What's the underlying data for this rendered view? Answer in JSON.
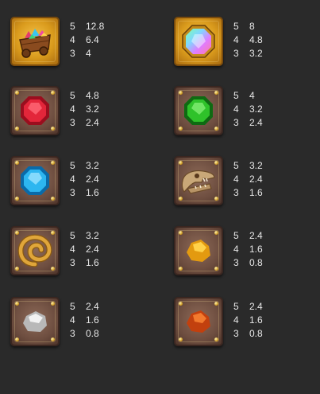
{
  "colors": {
    "background": "#2a2a2a",
    "text": "#e8e8e8"
  },
  "paytable": [
    {
      "symbol": "gem-cart-icon",
      "frame": "gold",
      "payouts": [
        {
          "count": "5",
          "value": "12.8"
        },
        {
          "count": "4",
          "value": "6.4"
        },
        {
          "count": "3",
          "value": "4"
        }
      ]
    },
    {
      "symbol": "rainbow-diamond-icon",
      "frame": "gold",
      "payouts": [
        {
          "count": "5",
          "value": "8"
        },
        {
          "count": "4",
          "value": "4.8"
        },
        {
          "count": "3",
          "value": "3.2"
        }
      ]
    },
    {
      "symbol": "red-gem-icon",
      "frame": "stone",
      "payouts": [
        {
          "count": "5",
          "value": "4.8"
        },
        {
          "count": "4",
          "value": "3.2"
        },
        {
          "count": "3",
          "value": "2.4"
        }
      ]
    },
    {
      "symbol": "green-gem-icon",
      "frame": "stone",
      "payouts": [
        {
          "count": "5",
          "value": "4"
        },
        {
          "count": "4",
          "value": "3.2"
        },
        {
          "count": "3",
          "value": "2.4"
        }
      ]
    },
    {
      "symbol": "blue-gem-icon",
      "frame": "stone",
      "payouts": [
        {
          "count": "5",
          "value": "3.2"
        },
        {
          "count": "4",
          "value": "2.4"
        },
        {
          "count": "3",
          "value": "1.6"
        }
      ]
    },
    {
      "symbol": "dinosaur-skull-icon",
      "frame": "stone",
      "payouts": [
        {
          "count": "5",
          "value": "3.2"
        },
        {
          "count": "4",
          "value": "2.4"
        },
        {
          "count": "3",
          "value": "1.6"
        }
      ]
    },
    {
      "symbol": "ammonite-fossil-icon",
      "frame": "stone",
      "payouts": [
        {
          "count": "5",
          "value": "3.2"
        },
        {
          "count": "4",
          "value": "2.4"
        },
        {
          "count": "3",
          "value": "1.6"
        }
      ]
    },
    {
      "symbol": "gold-nugget-icon",
      "frame": "stone",
      "payouts": [
        {
          "count": "5",
          "value": "2.4"
        },
        {
          "count": "4",
          "value": "1.6"
        },
        {
          "count": "3",
          "value": "0.8"
        }
      ]
    },
    {
      "symbol": "silver-nugget-icon",
      "frame": "stone",
      "payouts": [
        {
          "count": "5",
          "value": "2.4"
        },
        {
          "count": "4",
          "value": "1.6"
        },
        {
          "count": "3",
          "value": "0.8"
        }
      ]
    },
    {
      "symbol": "copper-nugget-icon",
      "frame": "stone",
      "payouts": [
        {
          "count": "5",
          "value": "2.4"
        },
        {
          "count": "4",
          "value": "1.6"
        },
        {
          "count": "3",
          "value": "0.8"
        }
      ]
    }
  ]
}
